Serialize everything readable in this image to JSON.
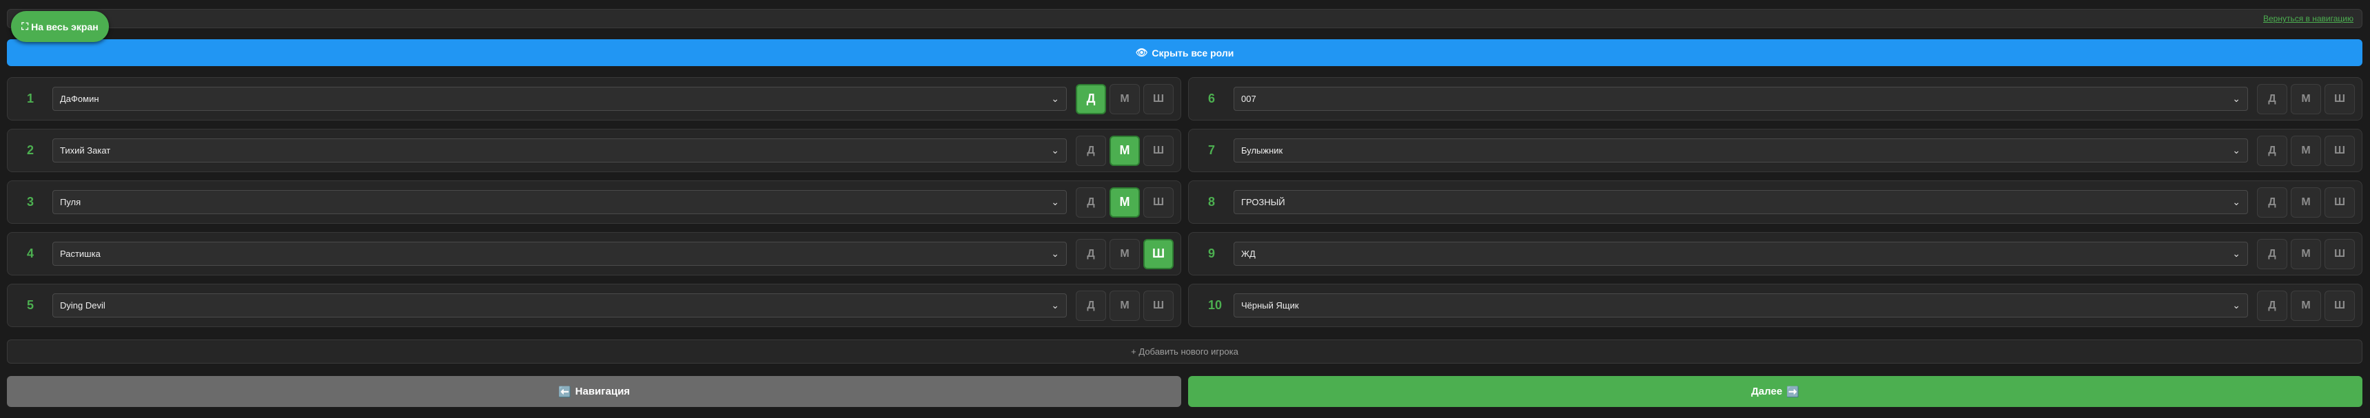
{
  "top": {
    "back_link": "Вернуться в навигацию",
    "fullscreen_icon": "⛶",
    "fullscreen_label": "На весь экран"
  },
  "hide_roles": {
    "icon": "👁",
    "label": "Скрыть все роли"
  },
  "role_labels": {
    "d": "Д",
    "m": "М",
    "sh": "Ш"
  },
  "players": [
    {
      "num": "1",
      "name": "ДаФомин",
      "active": "d"
    },
    {
      "num": "6",
      "name": "007",
      "active": ""
    },
    {
      "num": "2",
      "name": "Тихий Закат",
      "active": "m"
    },
    {
      "num": "7",
      "name": "Булыжник",
      "active": ""
    },
    {
      "num": "3",
      "name": "Пуля",
      "active": "m"
    },
    {
      "num": "8",
      "name": "ГРОЗНЫЙ",
      "active": ""
    },
    {
      "num": "4",
      "name": "Растишка",
      "active": "sh"
    },
    {
      "num": "9",
      "name": "ЖД",
      "active": ""
    },
    {
      "num": "5",
      "name": "Dying Devil",
      "active": ""
    },
    {
      "num": "10",
      "name": "Чёрный Ящик",
      "active": ""
    }
  ],
  "add_player": "+ Добавить нового игрока",
  "nav_button": {
    "icon": "⬅️",
    "label": "Навигация"
  },
  "next_button": {
    "label": "Далее",
    "icon": "➡️"
  },
  "colors": {
    "accent": "#4caf50",
    "blue": "#2196f3",
    "gray_button": "#6b6b6b"
  }
}
